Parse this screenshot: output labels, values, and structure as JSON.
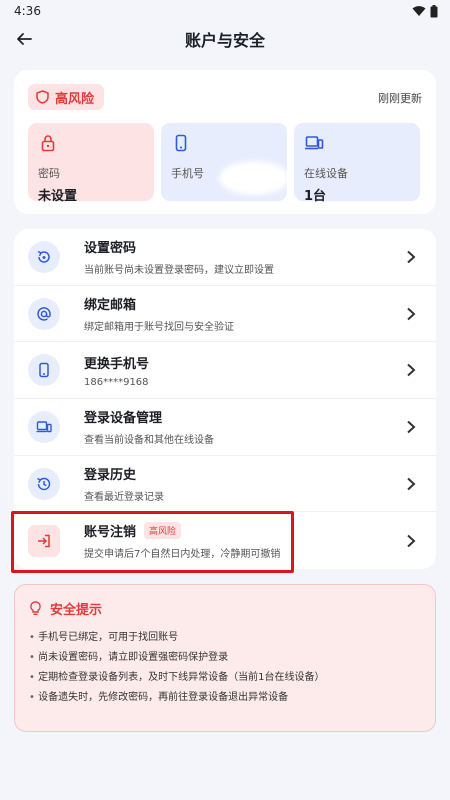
{
  "status_bar": {
    "time": "4:36"
  },
  "app_bar": {
    "title": "账户与安全"
  },
  "overview": {
    "risk_label": "高风险",
    "refresh_text": "刚刚更新",
    "tiles": [
      {
        "label": "密码",
        "value": "未设置",
        "icon": "lock-icon",
        "tone": "red"
      },
      {
        "label": "手机号",
        "value": "",
        "icon": "phone-icon",
        "tone": "blue"
      },
      {
        "label": "在线设备",
        "value": "1台",
        "icon": "devices-icon",
        "tone": "blue"
      }
    ]
  },
  "menu": {
    "items": [
      {
        "title": "设置密码",
        "subtitle": "当前账号尚未设置登录密码，建议立即设置",
        "icon": "password-reset-icon"
      },
      {
        "title": "绑定邮箱",
        "subtitle": "绑定邮箱用于账号找回与安全验证",
        "icon": "at-sign-icon"
      },
      {
        "title": "更换手机号",
        "subtitle": "186****9168",
        "icon": "phone-icon"
      },
      {
        "title": "登录设备管理",
        "subtitle": "查看当前设备和其他在线设备",
        "icon": "devices-icon"
      },
      {
        "title": "登录历史",
        "subtitle": "查看最近登录记录",
        "icon": "history-icon"
      },
      {
        "title": "账号注销",
        "subtitle": "提交申请后7个自然日内处理，冷静期可撤销",
        "badge": "高风险",
        "icon": "logout-icon"
      }
    ]
  },
  "tips": {
    "title": "安全提示",
    "items": [
      "手机号已绑定，可用于找回账号",
      "尚未设置密码，请立即设置强密码保护登录",
      "定期检查登录设备列表，及时下线异常设备（当前1台在线设备）",
      "设备遗失时，先修改密码，再前往登录设备退出异常设备"
    ]
  },
  "colors": {
    "accent_blue": "#2f5bd8",
    "danger_red": "#e23b3b",
    "background": "#f4f5fb"
  }
}
